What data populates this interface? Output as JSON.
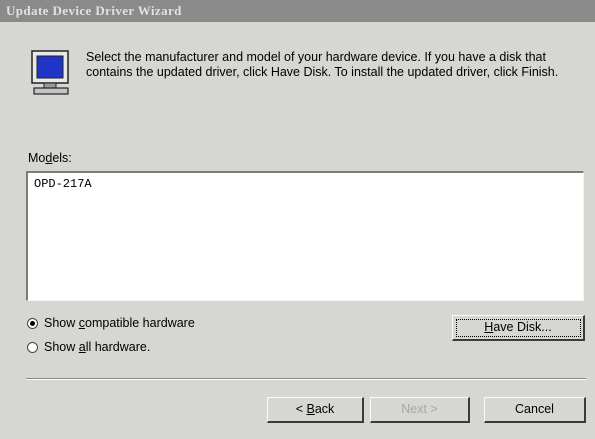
{
  "window": {
    "title": "Update Device Driver Wizard"
  },
  "icon": {
    "name": "monitor-icon"
  },
  "intro_text": "Select the manufacturer and model of your hardware device. If you have a disk that contains the updated driver, click Have Disk. To install the updated driver, click Finish.",
  "models": {
    "label": "Models:",
    "items": [
      "OPD-217A"
    ]
  },
  "options": {
    "show_compatible": {
      "label": "Show compatible hardware",
      "checked": true
    },
    "show_all": {
      "label": "Show all hardware.",
      "checked": false
    }
  },
  "buttons": {
    "have_disk": "Have Disk...",
    "back": "< Back",
    "next": "Next >",
    "cancel": "Cancel"
  },
  "colors": {
    "window_bg": "#d6d6d2",
    "titlebar_bg": "#8a8a8a",
    "icon_screen": "#1f35c8"
  }
}
